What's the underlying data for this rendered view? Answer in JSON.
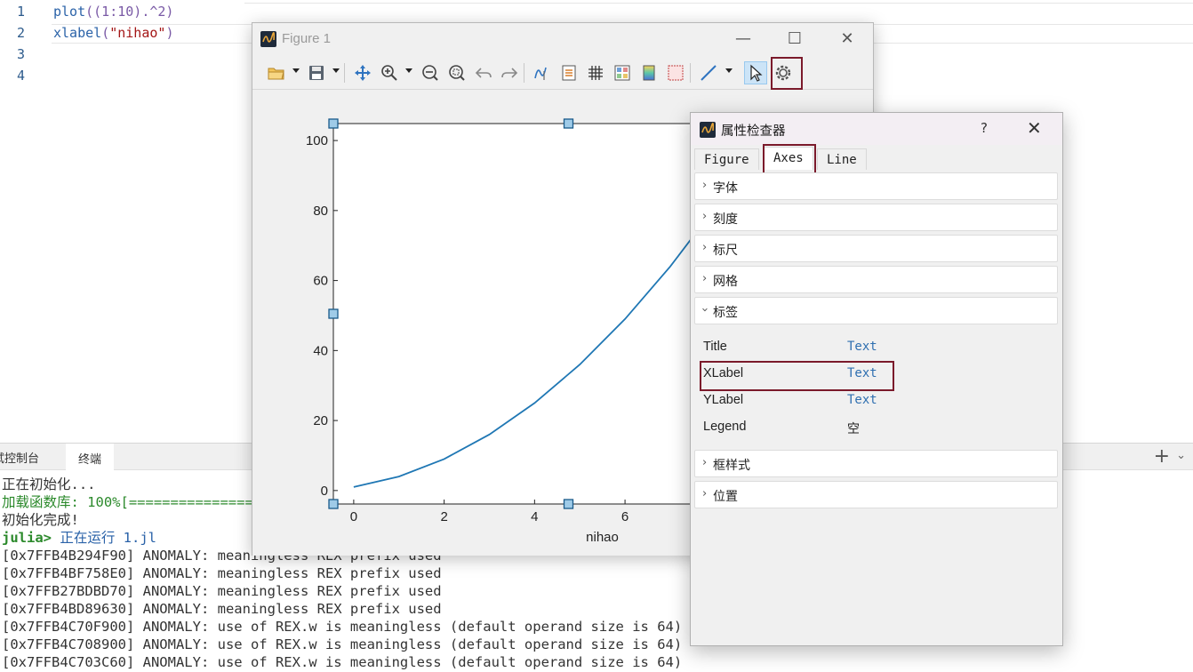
{
  "editor": {
    "line_numbers": [
      "1",
      "2",
      "3",
      "4"
    ],
    "line1": {
      "fn": "plot",
      "args": "((1:10).^2)"
    },
    "line2": {
      "fn": "xlabel",
      "args_open": "(",
      "string": "\"nihao\"",
      "args_close": ")"
    }
  },
  "panel": {
    "tabs": [
      "试控制台",
      "终端"
    ],
    "plus": "+",
    "lines": [
      {
        "text": "正在初始化...",
        "color": "#333333"
      },
      {
        "text": "加载函数库: 100%[================",
        "color": "#2c8a2c"
      },
      {
        "text": "初始化完成!",
        "color": "#333333"
      },
      {
        "prompt": "julia>",
        "text": " 正在运行 1.jl"
      },
      {
        "text": "[0x7FFB4B294F90] ANOMALY: meaningless REX prefix used"
      },
      {
        "text": "[0x7FFB4BF758E0] ANOMALY: meaningless REX prefix used"
      },
      {
        "text": "[0x7FFB27BDBD70] ANOMALY: meaningless REX prefix used"
      },
      {
        "text": "[0x7FFB4BD89630] ANOMALY: meaningless REX prefix used"
      },
      {
        "text": "[0x7FFB4C70F900] ANOMALY: use of REX.w is meaningless (default operand size is 64)"
      },
      {
        "text": "[0x7FFB4C708900] ANOMALY: use of REX.w is meaningless (default operand size is 64)"
      },
      {
        "text": "[0x7FFB4C703C60] ANOMALY: use of REX.w is meaningless (default operand size is 64)"
      }
    ]
  },
  "figure_window": {
    "title": "Figure 1",
    "controls": {
      "minimize": "—",
      "maximize": "☐",
      "close": "✕"
    },
    "toolbar_icons": [
      "open-icon",
      "save-icon",
      "pan-icon",
      "zoom-in-icon",
      "zoom-out-icon",
      "zoom-fit-icon",
      "undo-icon",
      "redo-icon",
      "data-cursor-icon",
      "legend-icon",
      "grid-icon",
      "subplot-icon",
      "colorbar-icon",
      "frame-icon",
      "line-icon",
      "select-icon",
      "settings-icon"
    ],
    "accent": "#7b1a2b"
  },
  "chart_data": {
    "type": "line",
    "x": [
      1,
      2,
      3,
      4,
      5,
      6,
      7,
      8,
      9,
      10
    ],
    "y": [
      1,
      4,
      9,
      16,
      25,
      36,
      49,
      64,
      81,
      100
    ],
    "xlabel": "nihao",
    "xticks": [
      "0",
      "2",
      "4",
      "6"
    ],
    "yticks": [
      "0",
      "20",
      "40",
      "60",
      "80",
      "100"
    ],
    "xlim": [
      -0.45,
      9.95
    ],
    "ylim": [
      -3.85,
      104.85
    ],
    "line_color": "#1f77b4",
    "grid": false
  },
  "inspector": {
    "title": "属性检查器",
    "help": "?",
    "close": "✕",
    "tabs": [
      "Figure",
      "Axes",
      "Line"
    ],
    "active_tab": "Axes",
    "sections_top": [
      "字体",
      "刻度",
      "标尺",
      "网格"
    ],
    "expanded_section": "标签",
    "properties": [
      {
        "name": "Title",
        "value": "Text"
      },
      {
        "name": "XLabel",
        "value": "Text"
      },
      {
        "name": "YLabel",
        "value": "Text"
      },
      {
        "name": "Legend",
        "value": "空"
      }
    ],
    "sections_bottom": [
      "框样式",
      "位置"
    ]
  }
}
